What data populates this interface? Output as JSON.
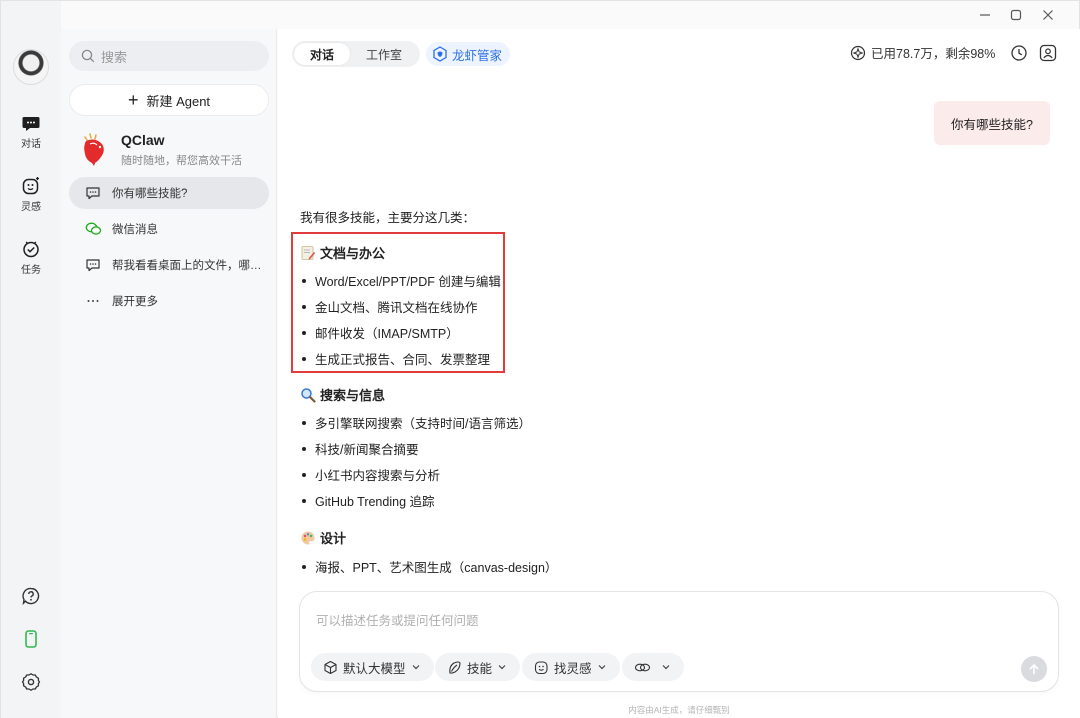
{
  "window": {
    "minimize_label": "—",
    "maximize_label": "□",
    "close_label": "✕"
  },
  "rail": {
    "items": [
      {
        "label": "对话",
        "icon": "chat-bubble-icon"
      },
      {
        "label": "灵感",
        "icon": "smile-sparkle-icon"
      },
      {
        "label": "任务",
        "icon": "check-circle-icon"
      }
    ],
    "bottom_icons": [
      "help-icon",
      "phone-icon",
      "settings-icon"
    ]
  },
  "sidebar": {
    "search_placeholder": "搜索",
    "new_agent_label": "新建 Agent",
    "agent": {
      "name": "QClaw",
      "subtitle": "随时随地，帮您高效干活"
    },
    "conversations": [
      {
        "label": "你有哪些技能?",
        "icon": "chat-icon",
        "active": true
      },
      {
        "label": "微信消息",
        "icon": "wechat-icon",
        "active": false
      },
      {
        "label": "帮我看看桌面上的文件，哪…",
        "icon": "chat-icon",
        "active": false
      },
      {
        "label": "展开更多",
        "icon": "more-icon",
        "active": false
      }
    ]
  },
  "header": {
    "tabs": [
      {
        "label": "对话",
        "active": true
      },
      {
        "label": "工作室",
        "active": false
      }
    ],
    "lobster_label": "龙虾管家",
    "usage_text": "已用78.7万，剩余98%"
  },
  "chat": {
    "user_message": "你有哪些技能?",
    "intro": "我有很多技能，主要分这几类：",
    "sections": [
      {
        "title": "文档与办公",
        "icon": "memo-emoji",
        "items": [
          "Word/Excel/PPT/PDF 创建与编辑",
          "金山文档、腾讯文档在线协作",
          "邮件收发（IMAP/SMTP）",
          "生成正式报告、合同、发票整理"
        ]
      },
      {
        "title": "搜索与信息",
        "icon": "magnifier-emoji",
        "items": [
          "多引擎联网搜索（支持时间/语言筛选）",
          "科技/新闻聚合摘要",
          "小红书内容搜索与分析",
          "GitHub Trending 追踪"
        ]
      },
      {
        "title": "设计",
        "icon": "palette-emoji",
        "items": [
          "海报、PPT、艺术图生成（canvas-design）"
        ]
      }
    ]
  },
  "composer": {
    "placeholder": "可以描述任务或提问任何问题",
    "chips": [
      {
        "label": "默认大模型",
        "icon": "cube-icon"
      },
      {
        "label": "技能",
        "icon": "leaf-icon"
      },
      {
        "label": "找灵感",
        "icon": "smile-icon"
      },
      {
        "label": "",
        "icon": "link-icon"
      }
    ],
    "footnote": "内容由AI生成，请仔细甄别"
  },
  "colors": {
    "highlight_box": "#e23b3b",
    "lobster_accent": "#2b6fe6",
    "user_bubble": "#fcebeb",
    "phone_icon": "#2fb84f"
  }
}
